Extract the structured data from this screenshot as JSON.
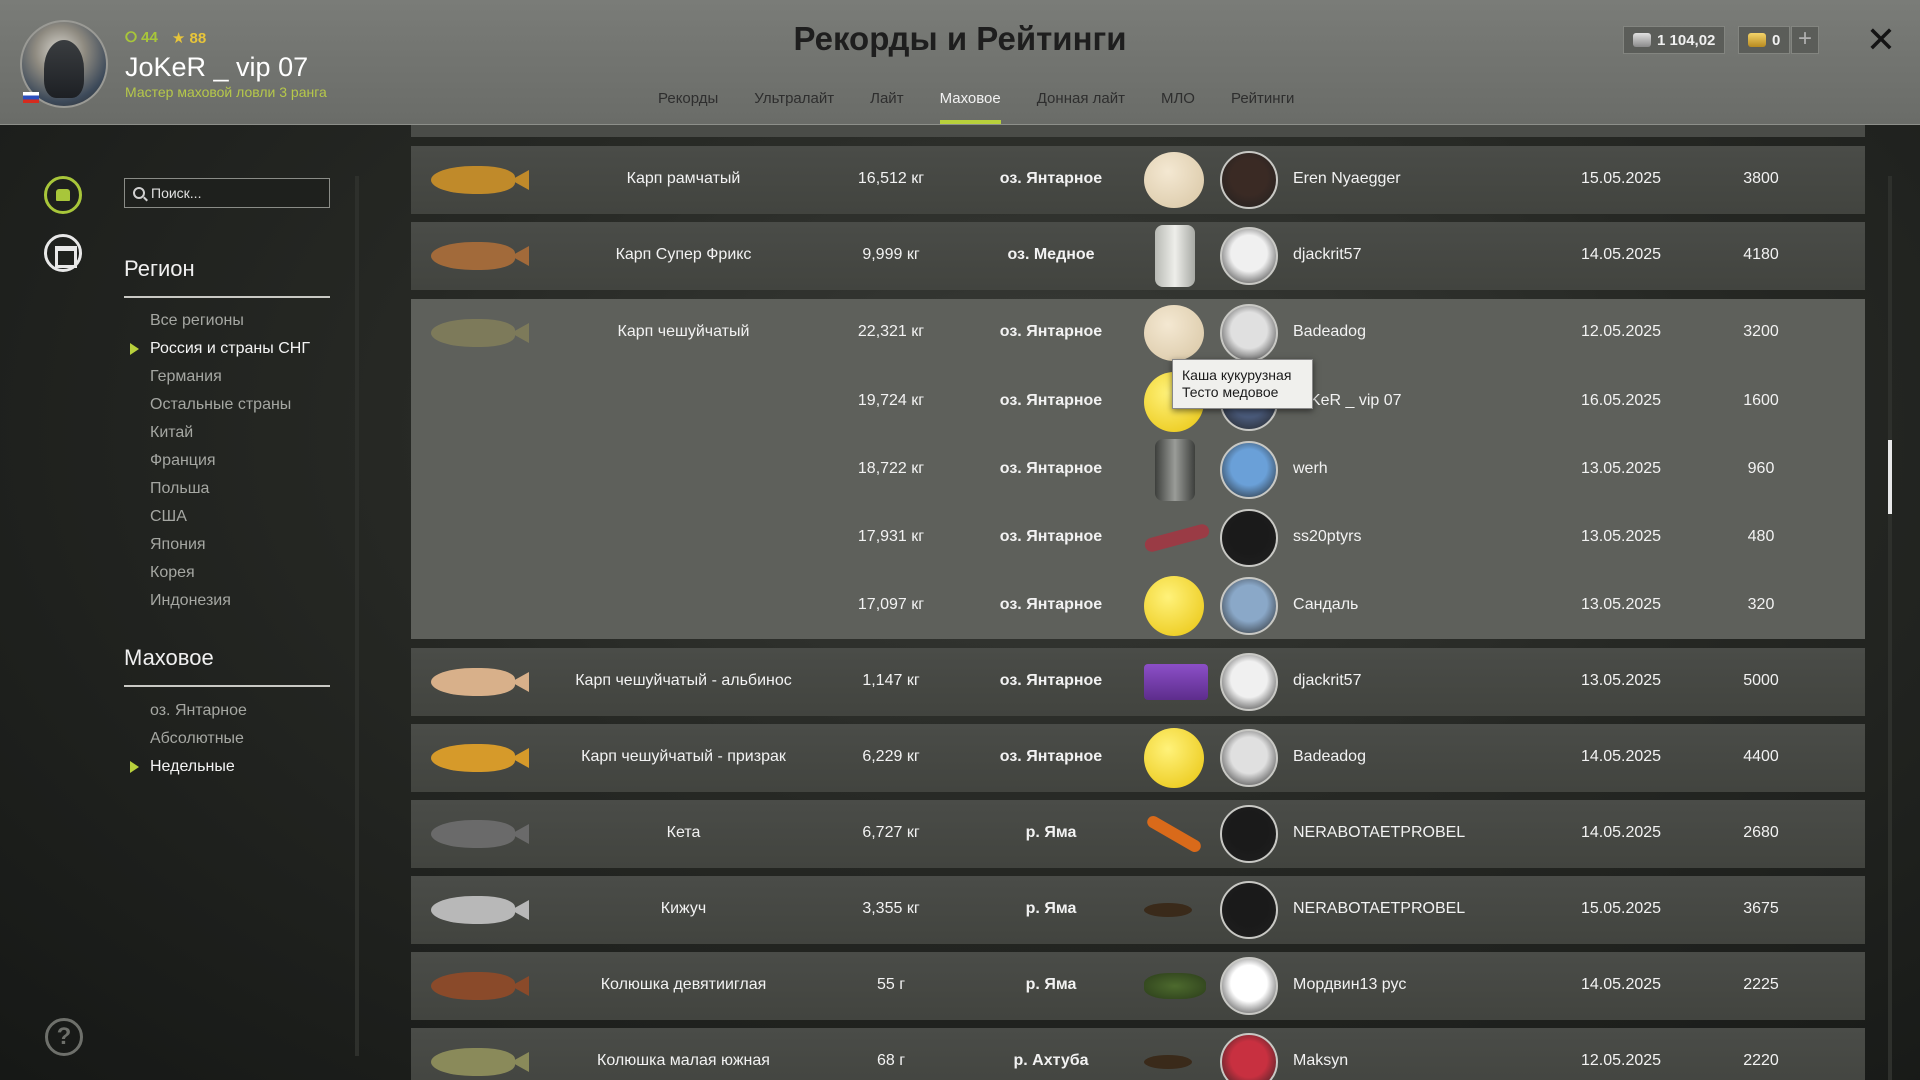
{
  "header": {
    "title": "Рекорды и Рейтинги",
    "username": "JoKeR _ vip 07",
    "rank_text": "Мастер маховой ловли 3 ранга",
    "stat_level": "44",
    "stat_stars": "88",
    "currency_silver": "1 104,02",
    "currency_gold": "0",
    "plus_label": "+",
    "close_label": "✕",
    "tabs": [
      "Рекорды",
      "Ультралайт",
      "Лайт",
      "Маховое",
      "Донная лайт",
      "МЛО",
      "Рейтинги"
    ],
    "active_tab": "Маховое",
    "accent_color": "#b8d03c"
  },
  "sidebar": {
    "search_placeholder": "Поиск...",
    "region_title": "Регион",
    "regions": [
      "Все регионы",
      "Россия и страны СНГ",
      "Германия",
      "Остальные страны",
      "Китай",
      "Франция",
      "Польша",
      "США",
      "Япония",
      "Корея",
      "Индонезия"
    ],
    "selected_region": "Россия и страны СНГ",
    "method_title": "Маховое",
    "lakes": [
      "оз. Янтарное",
      "Абсолютные",
      "Недельные"
    ],
    "selected_lake": "Недельные",
    "help_label": "?"
  },
  "records": [
    {
      "fish": "Карп рамчатый",
      "weight": "16,512 кг",
      "location": "оз. Янтарное",
      "player": "Eren Nyaegger",
      "date": "15.05.2025",
      "points": "3800",
      "bait": "ball-pale"
    },
    {
      "fish": "Карп Супер Фрикс",
      "weight": "9,999 кг",
      "location": "оз. Медное",
      "player": "djackrit57",
      "date": "14.05.2025",
      "points": "4180",
      "bait": "jar"
    },
    {
      "fish": "Карп чешуйчатый",
      "weight": "22,321 кг",
      "location": "оз. Янтарное",
      "player": "Badeadog",
      "date": "12.05.2025",
      "points": "3200",
      "bait": "ball-pale"
    },
    {
      "fish": "",
      "weight": "19,724 кг",
      "location": "оз. Янтарное",
      "player": "JoKeR _ vip 07",
      "date": "16.05.2025",
      "points": "1600",
      "bait": "ball-yellow"
    },
    {
      "fish": "",
      "weight": "18,722 кг",
      "location": "оз. Янтарное",
      "player": "werh",
      "date": "13.05.2025",
      "points": "960",
      "bait": "jar-dark"
    },
    {
      "fish": "",
      "weight": "17,931 кг",
      "location": "оз. Янтарное",
      "player": "ss20ptyrs",
      "date": "13.05.2025",
      "points": "480",
      "bait": "worm"
    },
    {
      "fish": "",
      "weight": "17,097 кг",
      "location": "оз. Янтарное",
      "player": "Сандаль",
      "date": "13.05.2025",
      "points": "320",
      "bait": "ball-yellow"
    },
    {
      "fish": "Карп чешуйчатый - альбинос",
      "weight": "1,147 кг",
      "location": "оз. Янтарное",
      "player": "djackrit57",
      "date": "13.05.2025",
      "points": "5000",
      "bait": "tub"
    },
    {
      "fish": "Карп чешуйчатый - призрак",
      "weight": "6,229 кг",
      "location": "оз. Янтарное",
      "player": "Badeadog",
      "date": "14.05.2025",
      "points": "4400",
      "bait": "ball-yellow"
    },
    {
      "fish": "Кета",
      "weight": "6,727 кг",
      "location": "р. Яма",
      "player": "NERABOTAETPROBEL",
      "date": "14.05.2025",
      "points": "2680",
      "bait": "shrimp"
    },
    {
      "fish": "Кижуч",
      "weight": "3,355 кг",
      "location": "р. Яма",
      "player": "NERABOTAETPROBEL",
      "date": "15.05.2025",
      "points": "3675",
      "bait": "bug"
    },
    {
      "fish": "Колюшка девятииглая",
      "weight": "55 г",
      "location": "р. Яма",
      "player": "Мордвин13 рус",
      "date": "14.05.2025",
      "points": "2225",
      "bait": "grass"
    },
    {
      "fish": "Колюшка малая южная",
      "weight": "68 г",
      "location": "р. Ахтуба",
      "player": "Maksyn",
      "date": "12.05.2025",
      "points": "2220",
      "bait": "bug"
    }
  ],
  "tooltip": {
    "line1": "Каша кукурузная",
    "line2": "Тесто медовое"
  }
}
